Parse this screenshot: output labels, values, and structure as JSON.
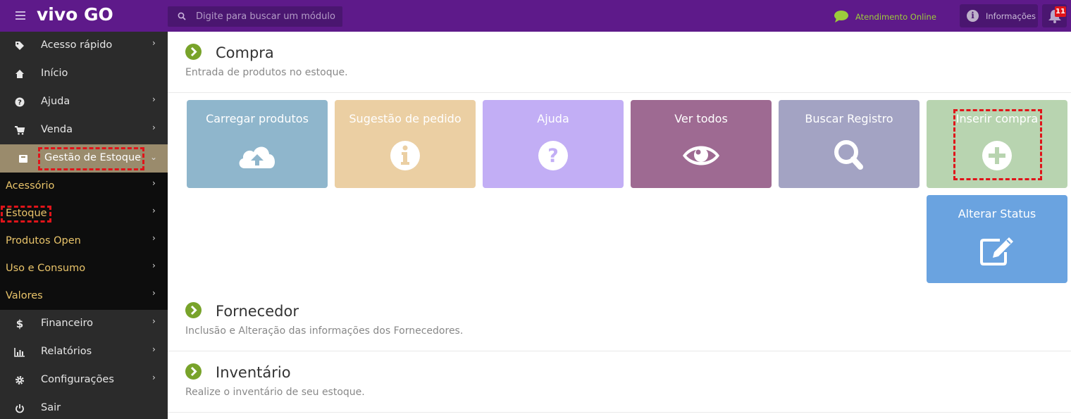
{
  "topbar": {
    "logo": "vivo GO",
    "search_placeholder": "Digite para buscar um módulo",
    "chat_label": "Atendimento Online",
    "info_label": "Informações",
    "notifications_count": "11",
    "colors": {
      "bar": "#5e1a8a",
      "accent_green": "#9ccc3b"
    }
  },
  "sidebar": {
    "items": [
      {
        "label": "Acesso rápido",
        "icon": "tag-icon"
      },
      {
        "label": "Início",
        "icon": "home-icon"
      },
      {
        "label": "Ajuda",
        "icon": "question-circle-icon"
      },
      {
        "label": "Venda",
        "icon": "cart-icon"
      },
      {
        "label": "Gestão de Estoque",
        "icon": "box-icon"
      }
    ],
    "submenu": [
      {
        "label": "Acessório"
      },
      {
        "label": "Estoque"
      },
      {
        "label": "Produtos Open"
      },
      {
        "label": "Uso e Consumo"
      },
      {
        "label": "Valores"
      }
    ],
    "bottom_items": [
      {
        "label": "Financeiro",
        "icon": "dollar-icon"
      },
      {
        "label": "Relatórios",
        "icon": "bar-chart-icon"
      },
      {
        "label": "Configurações",
        "icon": "gear-icon"
      },
      {
        "label": "Sair",
        "icon": "power-icon"
      }
    ]
  },
  "sections": {
    "compra": {
      "title": "Compra",
      "subtitle": "Entrada de produtos no estoque."
    },
    "fornecedor": {
      "title": "Fornecedor",
      "subtitle": "Inclusão e Alteração das informações dos Fornecedores."
    },
    "inventario": {
      "title": "Inventário",
      "subtitle": "Realize o inventário de seu estoque."
    }
  },
  "tiles": [
    {
      "label": "Carregar produtos",
      "icon": "cloud-upload-icon",
      "color": "#8fb6cc"
    },
    {
      "label": "Sugestão de pedido",
      "icon": "info-circle-icon",
      "color": "#ebcfa3"
    },
    {
      "label": "Ajuda",
      "icon": "question-circle-icon",
      "color": "#c2aef5"
    },
    {
      "label": "Ver todos",
      "icon": "eye-icon",
      "color": "#9e6a92"
    },
    {
      "label": "Buscar Registro",
      "icon": "search-icon",
      "color": "#a3a3c3"
    },
    {
      "label": "Inserir compra",
      "icon": "plus-circle-icon",
      "color": "#b8d4b0"
    },
    {
      "label": "Alterar Status",
      "icon": "edit-icon",
      "color": "#6aa3e0"
    }
  ]
}
